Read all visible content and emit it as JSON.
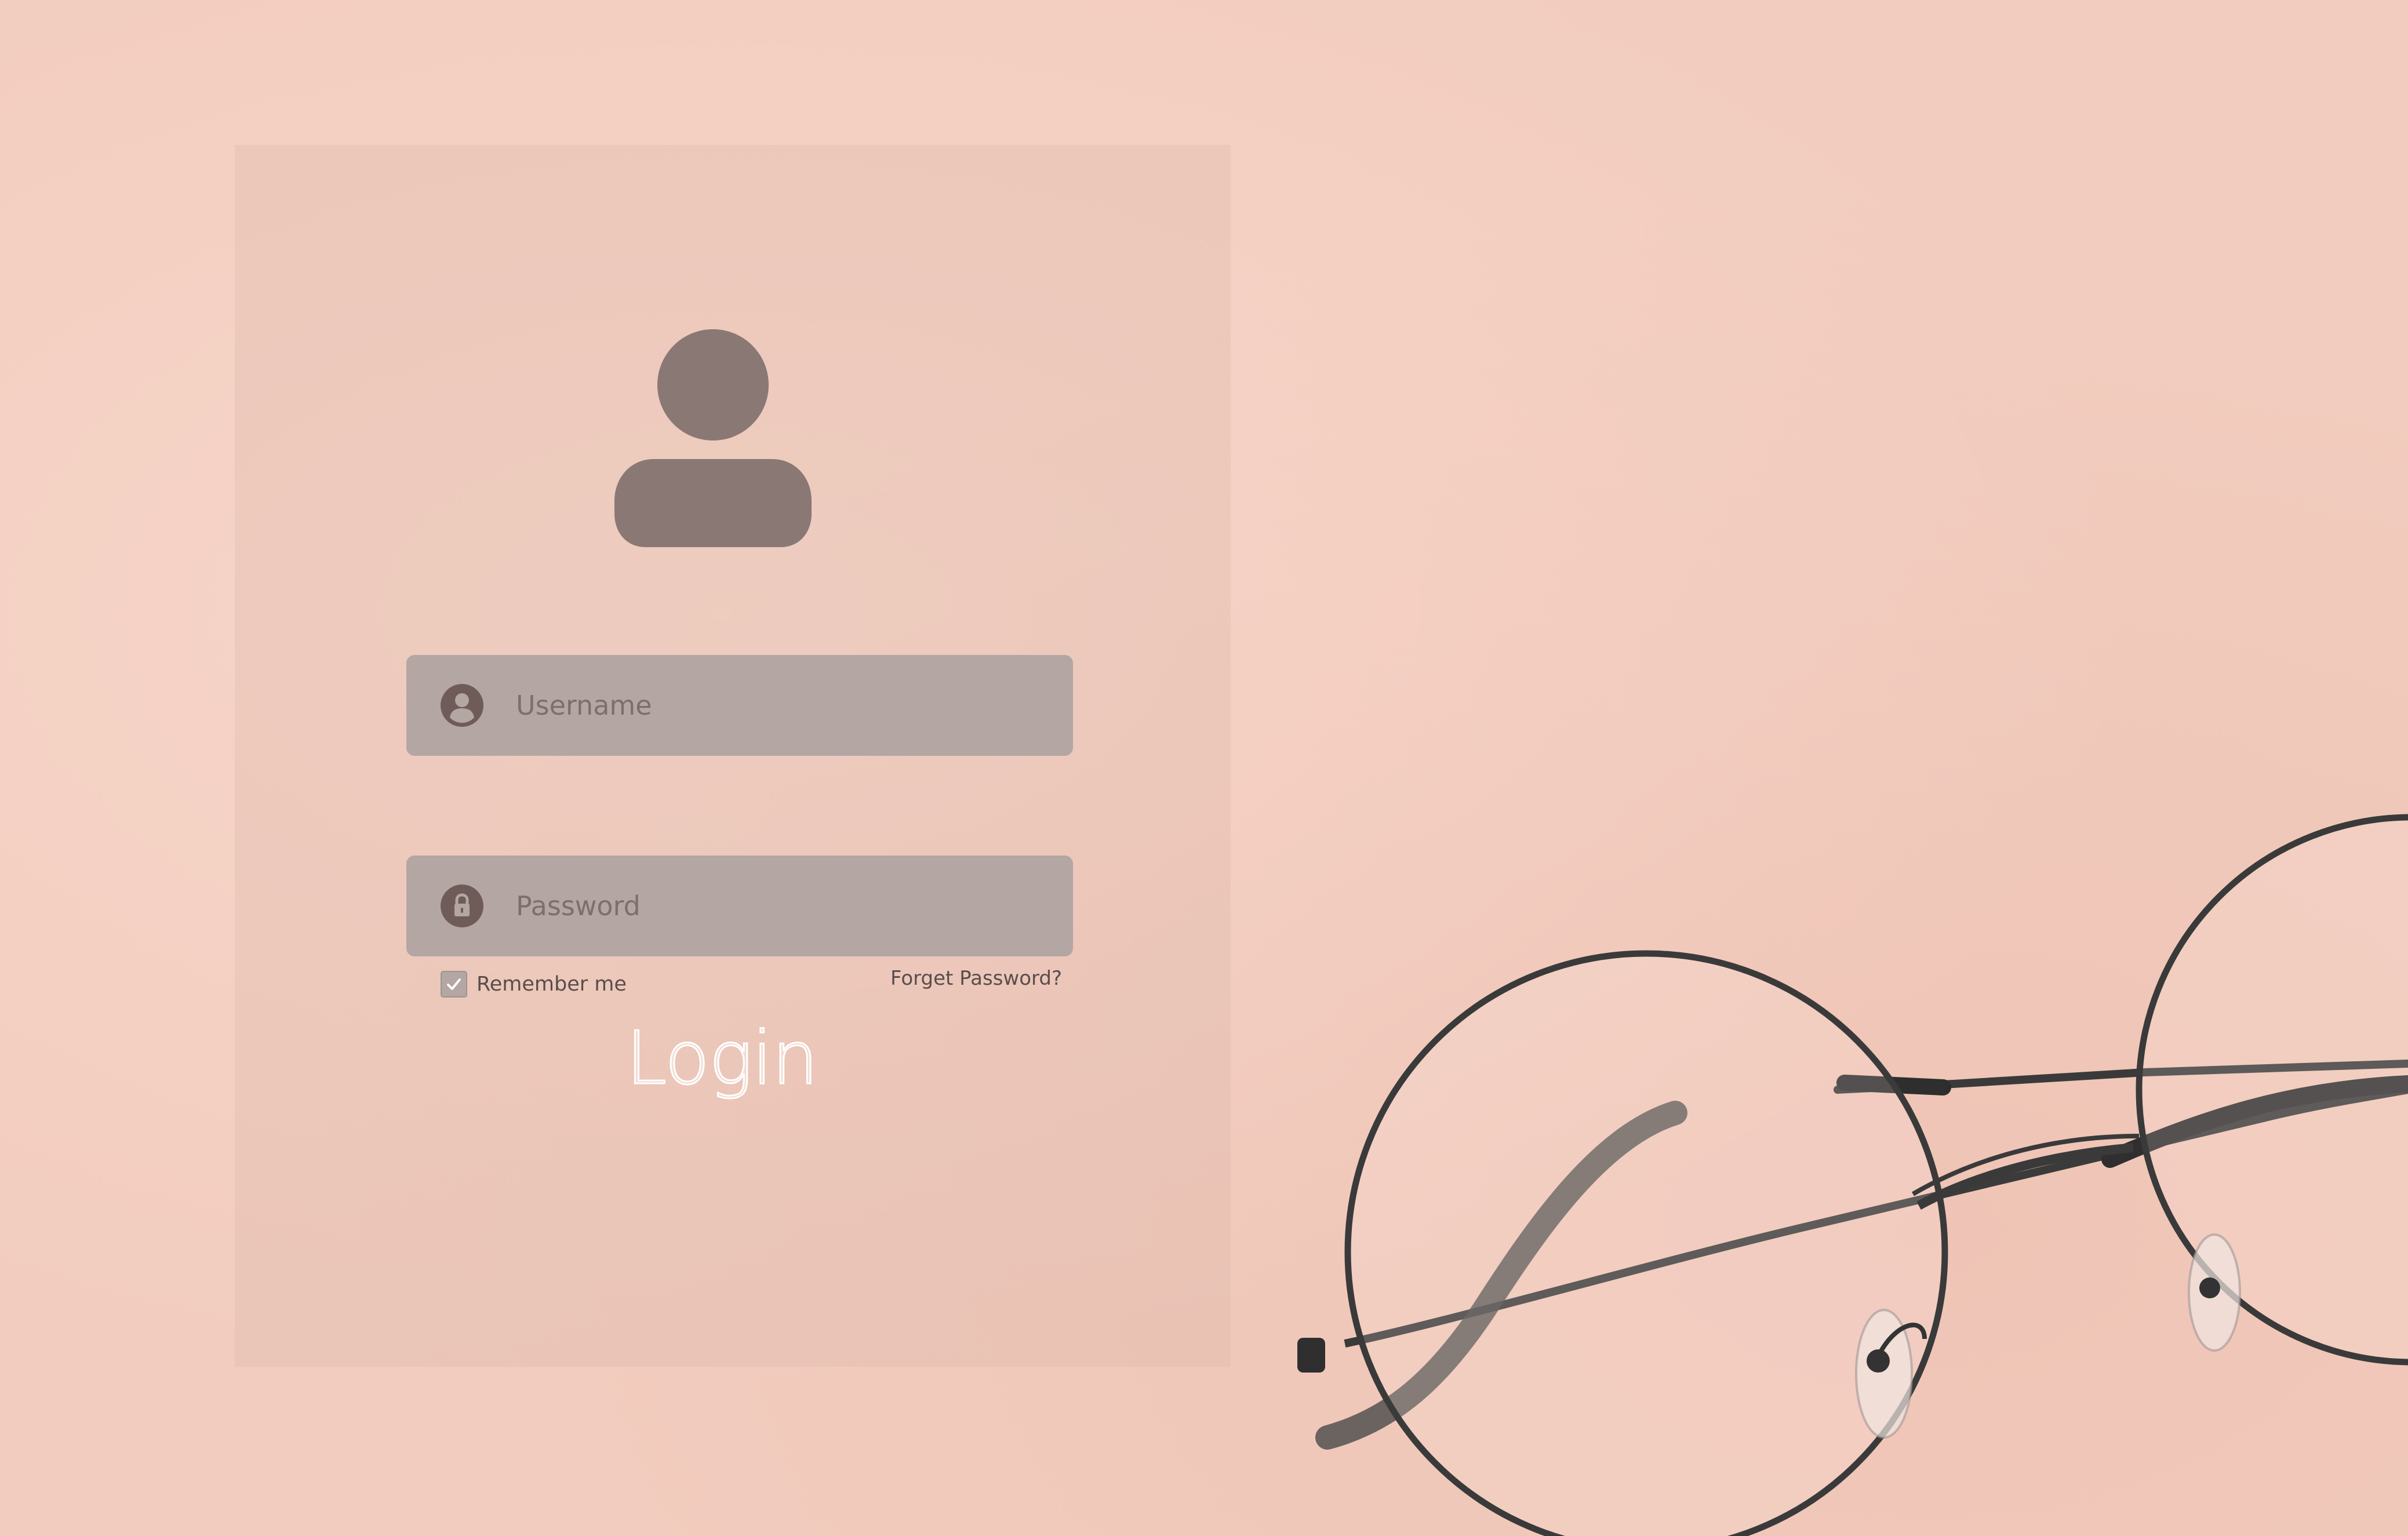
{
  "colors": {
    "background": "#f2cdbf",
    "field_fill": "#b3a6a3",
    "icon_fill": "#6f5c58",
    "avatar_fill": "#8a7874",
    "login_text": "#ffffff"
  },
  "avatar": {
    "icon": "user-avatar-icon"
  },
  "form": {
    "username": {
      "icon": "user-circle-icon",
      "placeholder": "Username",
      "value": ""
    },
    "password": {
      "icon": "lock-icon",
      "placeholder": "Password",
      "value": ""
    },
    "remember": {
      "label": "Remember me",
      "checked": true
    },
    "forgot_label": "Forget Password?",
    "login_label": "Login"
  },
  "decor": {
    "image": "round-eyeglasses"
  }
}
